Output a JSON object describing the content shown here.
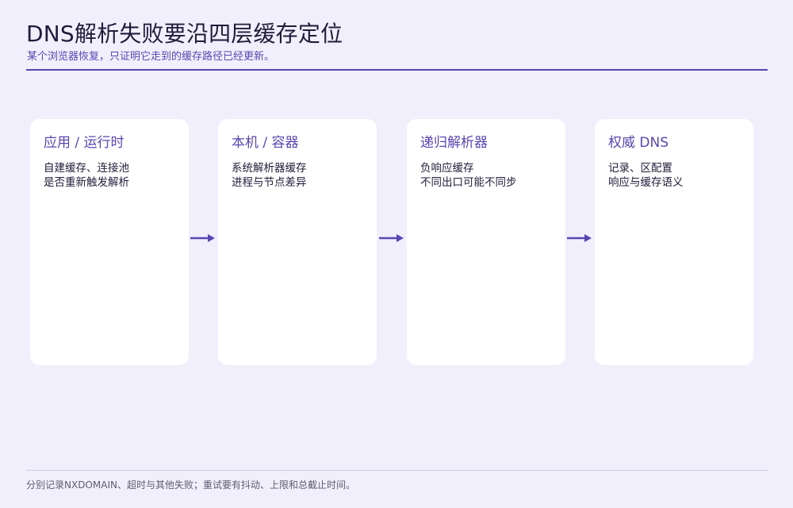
{
  "header": {
    "title": "DNS解析失败要沿四层缓存定位",
    "subtitle": "某个浏览器恢复，只证明它走到的缓存路径已经更新。"
  },
  "cards": [
    {
      "title": "应用 / 运行时",
      "lines": [
        "自建缓存、连接池",
        "是否重新触发解析"
      ]
    },
    {
      "title": "本机 / 容器",
      "lines": [
        "系统解析器缓存",
        "进程与节点差异"
      ]
    },
    {
      "title": "递归解析器",
      "lines": [
        "负响应缓存",
        "不同出口可能不同步"
      ]
    },
    {
      "title": "权威 DNS",
      "lines": [
        "记录、区配置",
        "响应与缓存语义"
      ]
    }
  ],
  "footer": {
    "note": "分别记录NXDOMAIN、超时与其他失败；重试要有抖动、上限和总截止时间。"
  },
  "colors": {
    "accent": "#5b45b3",
    "background": "#f1effc",
    "card": "#ffffff",
    "text": "#1f1d3a"
  }
}
